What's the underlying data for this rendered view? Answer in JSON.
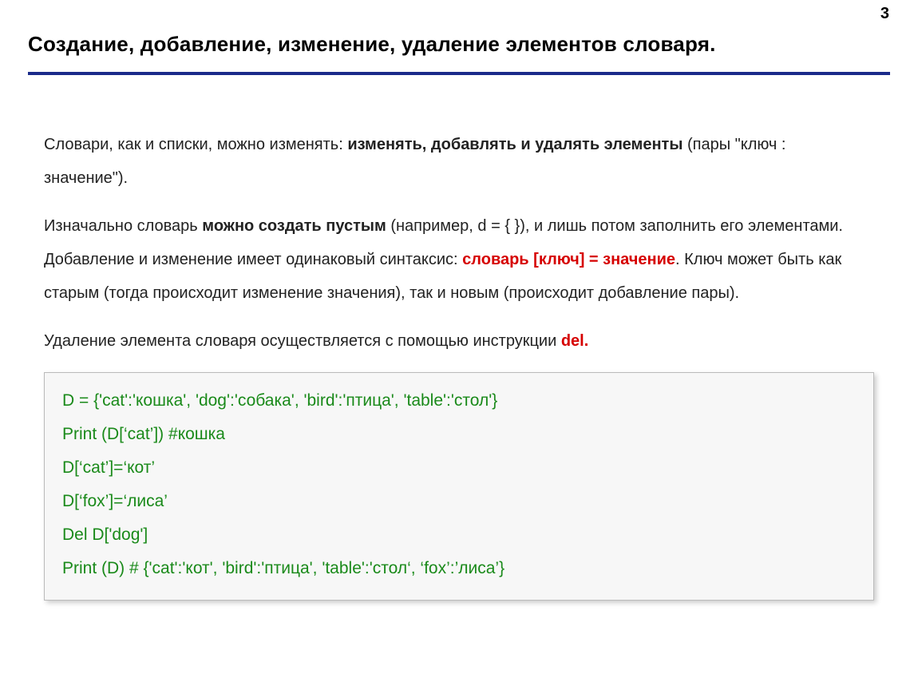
{
  "page_number": "3",
  "title": "Создание, добавление, изменение, удаление элементов словаря.",
  "para1": {
    "t1": "Словари, как и списки, можно изменять: ",
    "b1": "изменять, добавлять и  удалять элементы",
    "t2": " (пары \"ключ :   значение\")."
  },
  "para2": {
    "t1": "Изначально словарь ",
    "b1": "можно создать пустым",
    "t2": " (например, d = { }), и лишь потом заполнить его элементами.  Добавление и изменение имеет одинаковый синтаксис: ",
    "r1": "словарь [ключ] = значение",
    "t3": ". Ключ может быть как старым (тогда происходит изменение значения), так и новым (происходит добавление пары)."
  },
  "para3": {
    "t1": "Удаление элемента словаря осуществляется с помощью инструкции ",
    "r1": "del."
  },
  "code": {
    "l1": "D = {'cat':'кошка', 'dog':'собака',  'bird':'птица',  'table':'стол'}",
    "l2": "Print (D[‘cat’]) #кошка",
    "l3": "D[‘cat’]=‘кот’",
    "l4": "D[‘fox’]=‘лиса’",
    "l5": "Del D['dog']",
    "l6": "Print (D) # {'cat':'кот', 'bird':'птица',  'table':'стол‘, ‘fox’:’лиса’}"
  }
}
